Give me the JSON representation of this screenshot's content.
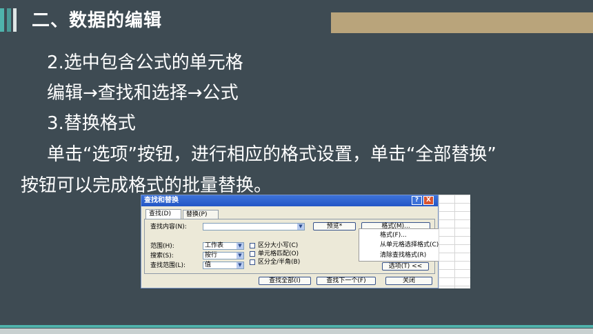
{
  "slide": {
    "title": "二、数据的编辑",
    "lines": [
      "2.选中包含公式的单元格",
      "编辑→查找和选择→公式",
      "3.替换格式",
      "单击“选项”按钮，进行相应的格式设置，单击“全部替换”",
      "按钮可以完成格式的批量替换。"
    ]
  },
  "dialog": {
    "title": "查找和替换",
    "help": "?",
    "close": "X",
    "tabs": [
      "查找(D)",
      "替换(P)"
    ],
    "find_label": "查找内容(N):",
    "preview_button": "预览*",
    "format_button": "格式(M)...",
    "within_label": "范围(H):",
    "within_value": "工作表",
    "search_label": "搜索(S):",
    "search_value": "按行",
    "lookin_label": "查找范围(L):",
    "lookin_value": "值",
    "checkbox_case": "区分大小写(C)",
    "checkbox_whole": "单元格匹配(O)",
    "checkbox_width": "区分全/半角(B)",
    "options_button": "选项(T) <<",
    "find_all_button": "查找全部(I)",
    "find_next_button": "查找下一个(F)",
    "close_button": "关闭"
  },
  "format_menu": {
    "items": [
      "格式(F)...",
      "从单元格选择格式(C)...",
      "清除查找格式(R)"
    ]
  }
}
